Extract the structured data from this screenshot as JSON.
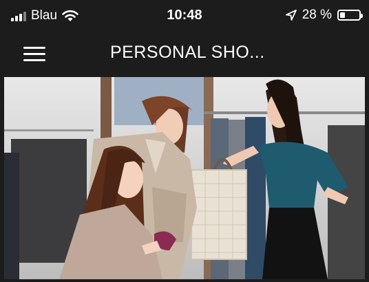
{
  "status_bar": {
    "carrier": "Blau",
    "time": "10:48",
    "battery_text": "28 %",
    "battery_level": 0.28,
    "icons": [
      "signal-icon",
      "wifi-icon",
      "location-arrow-icon",
      "battery-icon"
    ]
  },
  "nav": {
    "title": "PERSONAL SHO...",
    "menu_icon": "hamburger-menu-icon"
  },
  "hero": {
    "subject": "photo"
  },
  "colors": {
    "bar_background": "#1c1c1c",
    "text": "#ffffff"
  }
}
